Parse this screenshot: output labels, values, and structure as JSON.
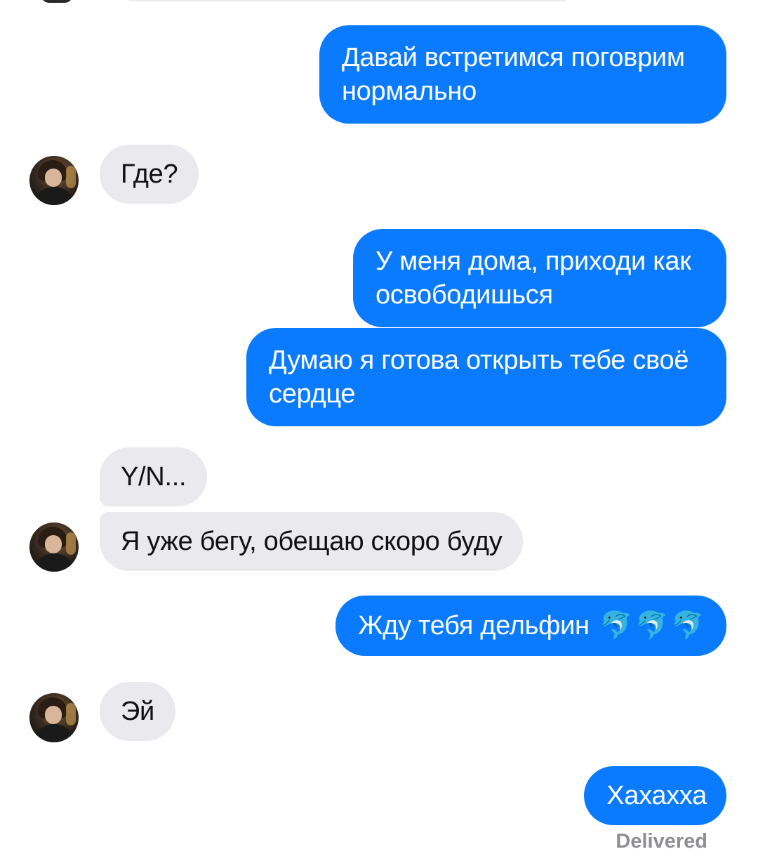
{
  "conversation": {
    "messages": [
      {
        "side": "out",
        "lines": [
          "Давай встретимся поговрим",
          "нормально"
        ]
      },
      {
        "side": "in",
        "text": "Где?"
      },
      {
        "side": "out",
        "lines": [
          "У меня дома, приходи как",
          "освободишься"
        ]
      },
      {
        "side": "out",
        "lines": [
          "Думаю я готова открыть тебе своё",
          "сердце"
        ]
      },
      {
        "side": "in",
        "text": "Y/N..."
      },
      {
        "side": "in",
        "text": "Я уже бегу, обещаю скоро буду"
      },
      {
        "side": "out",
        "text": "Жду тебя дельфин",
        "emoji": [
          "🐬",
          "🐬",
          "🐬"
        ]
      },
      {
        "side": "in",
        "text": "Эй"
      },
      {
        "side": "out",
        "text": "Хахахха"
      }
    ],
    "status": "Delivered"
  },
  "contact": {
    "avatar_icon": "contact-avatar"
  },
  "colors": {
    "outgoing_bubble": "#0a7bff",
    "incoming_bubble": "#e9e9ee",
    "status_text": "#8e8e93"
  }
}
